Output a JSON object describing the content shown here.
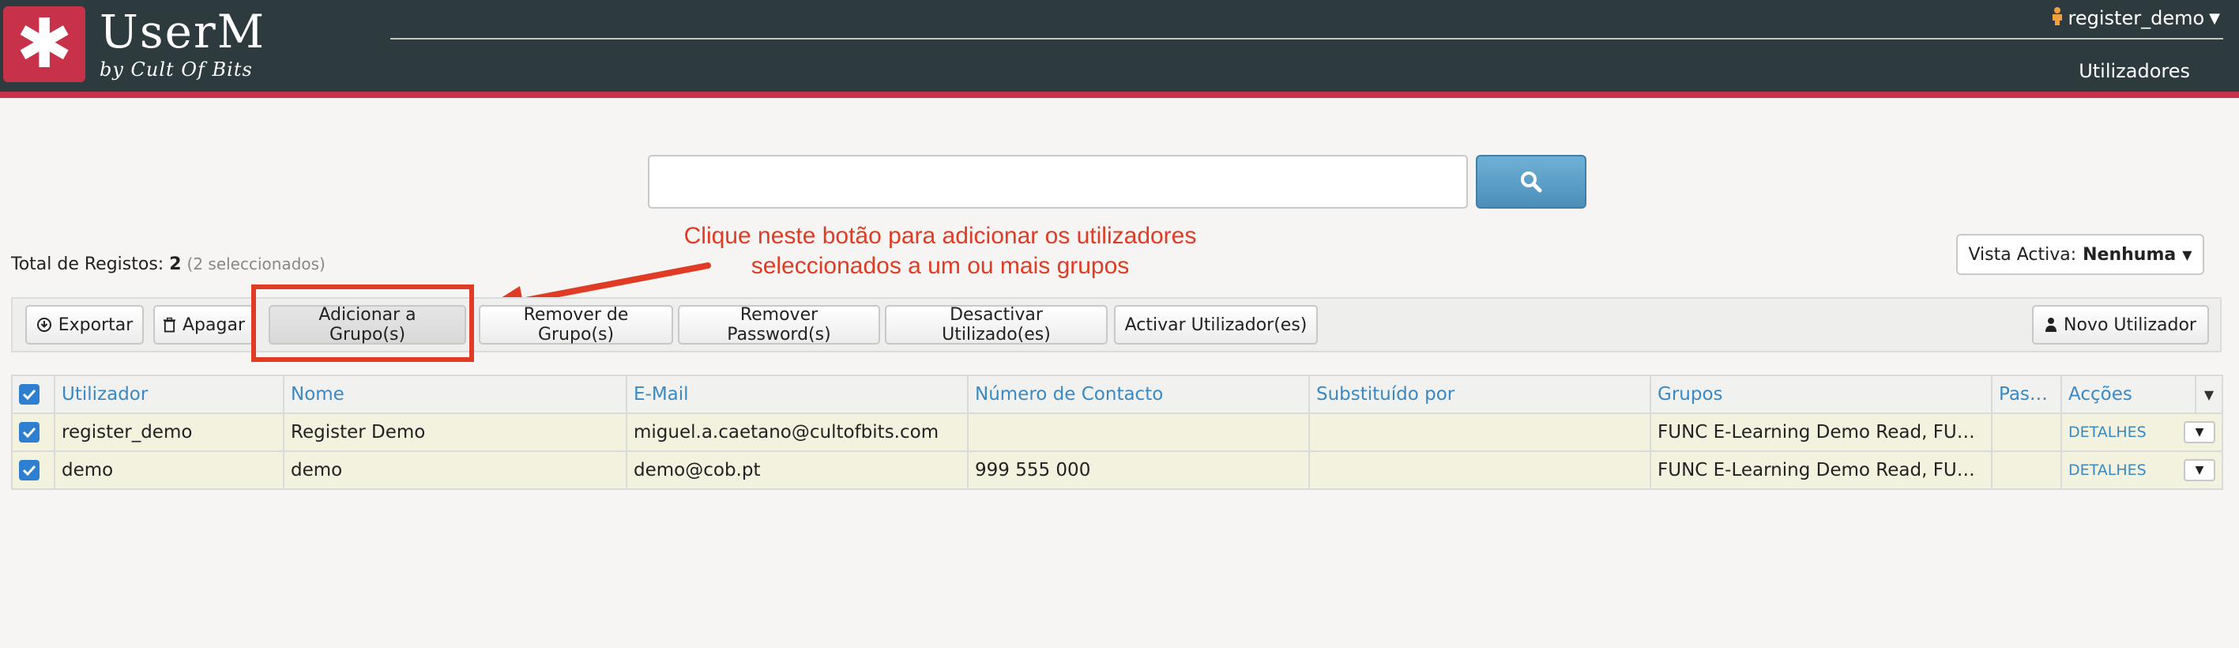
{
  "header": {
    "logo_glyph": "✱",
    "app_title": "UserM",
    "app_subtitle": "by Cult Of Bits",
    "username": "register_demo",
    "nav_link": "Utilizadores"
  },
  "search": {
    "placeholder": "",
    "value": ""
  },
  "annotation": {
    "line1": "Clique neste botão para adicionar os utilizadores",
    "line2": "seleccionados a um ou mais grupos"
  },
  "summary": {
    "label": "Total de Registos:",
    "count": "2",
    "selected": "(2 seleccionados)"
  },
  "vista": {
    "label": "Vista Activa:",
    "value": "Nenhuma"
  },
  "toolbar": {
    "export": "Exportar",
    "delete": "Apagar",
    "add_group": "Adicionar a Grupo(s)",
    "remove_group": "Remover de Grupo(s)",
    "remove_password": "Remover Password(s)",
    "deactivate": "Desactivar Utilizado(es)",
    "activate": "Activar Utilizador(es)",
    "new_user": "Novo Utilizador"
  },
  "table": {
    "columns": [
      "Utilizador",
      "Nome",
      "E-Mail",
      "Número de Contacto",
      "Substituído por",
      "Grupos",
      "Pass...",
      "Acções"
    ],
    "rows": [
      {
        "user": "register_demo",
        "name": "Register Demo",
        "email": "miguel.a.caetano@cultofbits.com",
        "contact": "",
        "substitute": "",
        "groups": "FUNC E-Learning Demo Read, FUNC E-Learning Demo Write",
        "pass": "",
        "action": "DETALHES"
      },
      {
        "user": "demo",
        "name": "demo",
        "email": "demo@cob.pt",
        "contact": "999 555 000",
        "substitute": "",
        "groups": "FUNC E-Learning Demo Read, FUNC E-Learning Demo Write",
        "pass": "",
        "action": "DETALHES"
      }
    ]
  },
  "colors": {
    "header_bg": "#2e3b3e",
    "brand_red": "#c8314a",
    "link_blue": "#3a88c4",
    "annotation_red": "#e03b24",
    "row_bg": "#f3f2df"
  }
}
